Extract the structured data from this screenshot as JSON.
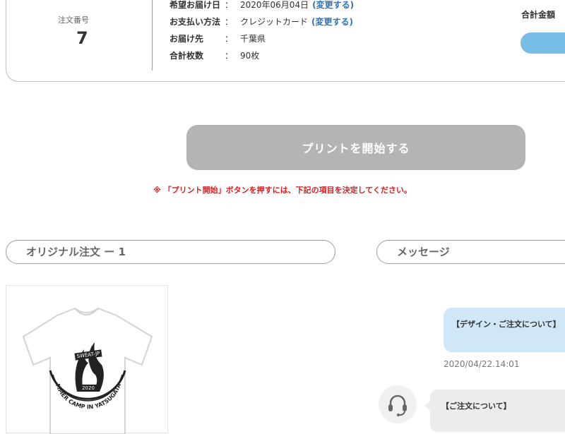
{
  "order": {
    "number_label": "注文番号",
    "number": "7",
    "rows": [
      {
        "key": "希望お届け日",
        "colon": "：",
        "value": "2020年06月04日",
        "link": "(変更する)"
      },
      {
        "key": "お支払い方法",
        "colon": "：",
        "value": "クレジットカード",
        "link": "(変更する)"
      },
      {
        "key": "お届け先",
        "colon": "：",
        "value": "千葉県",
        "link": ""
      },
      {
        "key": "合計枚数",
        "colon": "：",
        "value": "90枚",
        "link": ""
      }
    ],
    "total_label": "合計金額"
  },
  "print": {
    "button_label": "プリントを開始する",
    "warning": "※ 「プリント開始」ボタンを押すには、下記の項目を決定してください。"
  },
  "sections": {
    "original_order": "オリジナル注文 ー 1",
    "message": "メッセージ"
  },
  "product": {
    "print_text_top": "SWEAT-JP",
    "print_year": "2020",
    "print_text_arc": "SUMMER CAMP IN YATSUGATAKE"
  },
  "messages": [
    {
      "text": "【デザイン・ご注文について】",
      "timestamp": "2020/04/22.14:01"
    },
    {
      "text": "【ご注文について】"
    }
  ],
  "colors": {
    "accent_blue": "#2f73b8",
    "total_button": "#76bde8",
    "warning_red": "#d51f1f",
    "print_button_disabled": "#b4b4b4",
    "bubble_blue": "#cfe7f6"
  }
}
